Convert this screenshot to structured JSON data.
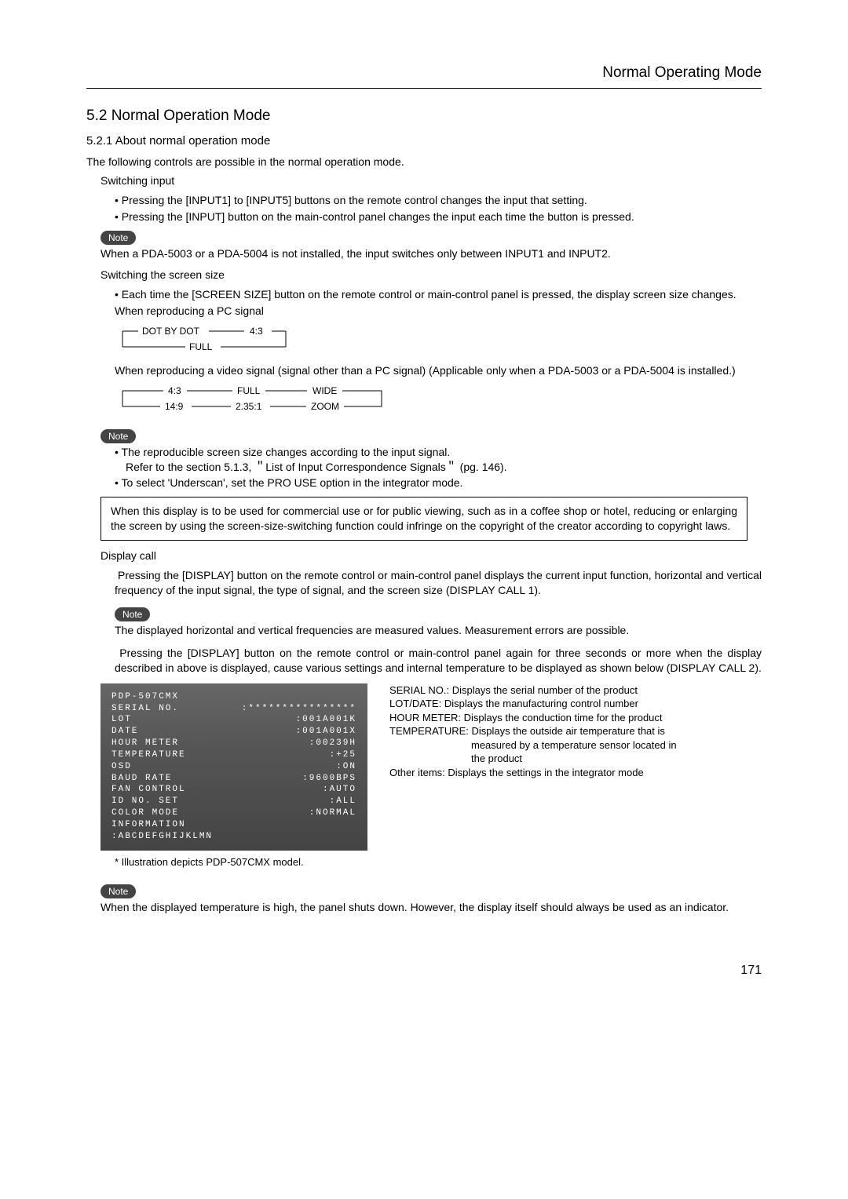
{
  "header": {
    "title": "Normal Operating Mode"
  },
  "sec": {
    "h2": "5.2 Normal Operation Mode",
    "h3": "5.2.1 About normal operation mode",
    "intro": "The following controls are possible in the normal operation mode."
  },
  "switch_input": {
    "title": "Switching input",
    "b1": "Pressing the [INPUT1] to [INPUT5] buttons on the remote control changes the input that setting.",
    "b2": "Pressing the [INPUT] button on the main-control panel changes the input each time the button is pressed."
  },
  "note_label": "Note",
  "note1": "When a PDA-5003 or a PDA-5004 is not installed, the input switches only between INPUT1 and INPUT2.",
  "switch_size": {
    "title": "Switching the screen size",
    "b1": "Each time the [SCREEN SIZE] button on the remote control or main-control panel is pressed, the display screen size changes.",
    "pc_caption": "When reproducing a PC signal",
    "video_caption": "When reproducing a video signal (signal other than a PC signal)    (Applicable only when a PDA-5003 or a PDA-5004 is installed.)"
  },
  "diagram_pc": {
    "a": "DOT BY DOT",
    "b": "4:3",
    "c": "FULL"
  },
  "diagram_video": {
    "a": "4:3",
    "b": "FULL",
    "c": "WIDE",
    "d": "14:9",
    "e": "2.35:1",
    "f": "ZOOM"
  },
  "note2": {
    "b1": "The reproducible screen size changes according to the input signal.",
    "b1_ref": "Refer to the section 5.1.3, ＂List of Input Correspondence Signals＂ (pg. 146).",
    "b2": "To select 'Underscan', set the PRO USE option in the integrator mode."
  },
  "legal_box": "When this display is to be used for commercial use or for public viewing, such as in a coffee shop or hotel, reducing or enlarging the screen by using the screen-size-switching function could infringe on the copyright of the creator according to copyright laws.",
  "display_call": {
    "title": "Display call",
    "p1": "Pressing the [DISPLAY] button on the remote control or main-control panel displays the current input function, horizontal and vertical frequency of the input signal, the type of signal, and the screen size (DISPLAY CALL 1).",
    "note": "The displayed horizontal and vertical frequencies are measured values. Measurement errors are possible.",
    "p2": "Pressing the [DISPLAY] button on the remote control or main-control panel again for three seconds or more when the display described in     above is displayed, cause various settings and internal temperature to be displayed as shown below (DISPLAY CALL 2)."
  },
  "osd": {
    "model": "PDP-507CMX",
    "rows": [
      {
        "k": "SERIAL NO.",
        "v": ":****************"
      },
      {
        "k": "LOT",
        "v": ":001A001K"
      },
      {
        "k": "DATE",
        "v": ":001A001X"
      },
      {
        "k": "HOUR METER",
        "v": ":00239H"
      },
      {
        "k": "TEMPERATURE",
        "v": ":+25"
      },
      {
        "k": "OSD",
        "v": ":ON"
      },
      {
        "k": "BAUD RATE",
        "v": ":9600BPS"
      },
      {
        "k": "FAN CONTROL",
        "v": ":AUTO"
      },
      {
        "k": "ID NO. SET",
        "v": ":ALL"
      },
      {
        "k": "COLOR MODE",
        "v": ":NORMAL"
      }
    ],
    "info_k": "INFORMATION",
    "info_v": ":ABCDEFGHIJKLMN"
  },
  "osd_desc": {
    "l1": "SERIAL NO.: Displays the serial number of the product",
    "l2": "LOT/DATE: Displays the manufacturing control number",
    "l3": "HOUR METER: Displays the conduction time for the product",
    "l4a": "TEMPERATURE: Displays the outside air temperature that is",
    "l4b": "measured by a temperature sensor located in",
    "l4c": "the product",
    "l5": "Other items: Displays the settings in the integrator mode"
  },
  "illus_note": "* Illustration depicts PDP-507CMX model.",
  "note4": "When the displayed temperature is high, the panel shuts down. However, the display itself should always be used as an indicator.",
  "page_number": "171"
}
